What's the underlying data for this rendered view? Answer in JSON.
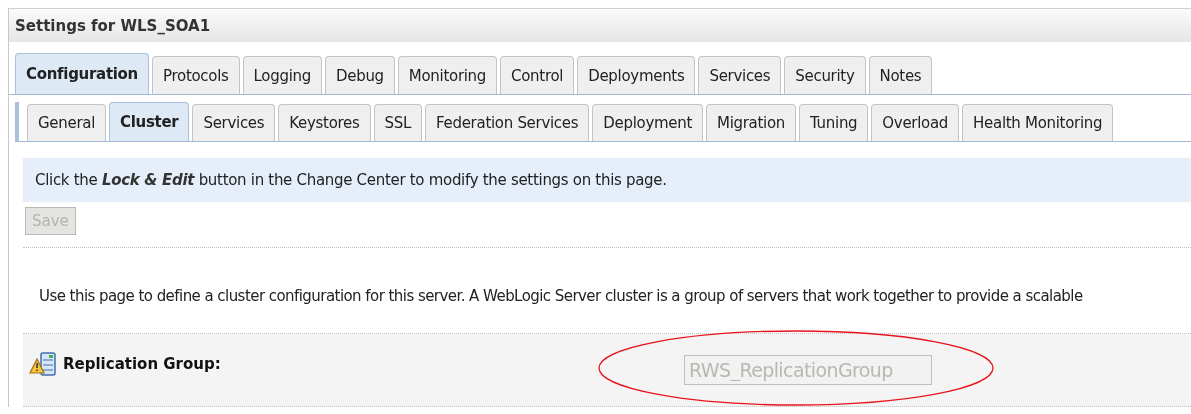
{
  "panel": {
    "title": "Settings for WLS_SOA1"
  },
  "tabs": [
    {
      "label": "Configuration",
      "selected": true
    },
    {
      "label": "Protocols",
      "selected": false
    },
    {
      "label": "Logging",
      "selected": false
    },
    {
      "label": "Debug",
      "selected": false
    },
    {
      "label": "Monitoring",
      "selected": false
    },
    {
      "label": "Control",
      "selected": false
    },
    {
      "label": "Deployments",
      "selected": false
    },
    {
      "label": "Services",
      "selected": false
    },
    {
      "label": "Security",
      "selected": false
    },
    {
      "label": "Notes",
      "selected": false
    }
  ],
  "subtabs": [
    {
      "label": "General",
      "selected": false
    },
    {
      "label": "Cluster",
      "selected": true
    },
    {
      "label": "Services",
      "selected": false
    },
    {
      "label": "Keystores",
      "selected": false
    },
    {
      "label": "SSL",
      "selected": false
    },
    {
      "label": "Federation Services",
      "selected": false
    },
    {
      "label": "Deployment",
      "selected": false
    },
    {
      "label": "Migration",
      "selected": false
    },
    {
      "label": "Tuning",
      "selected": false
    },
    {
      "label": "Overload",
      "selected": false
    },
    {
      "label": "Health Monitoring",
      "selected": false
    }
  ],
  "notice": "Click the **Lock & Edit** button in the Change Center to modify the settings on this page.",
  "save_button": {
    "label": "Save",
    "disabled": true
  },
  "description": "Use this page to define a cluster configuration for this server. A WebLogic Server cluster is a group of servers that work together to provide a scalable",
  "fields": [
    {
      "label": "Replication Group:",
      "value": "RWS_ReplicationGroup",
      "disabled": true,
      "highlighted": true
    }
  ]
}
